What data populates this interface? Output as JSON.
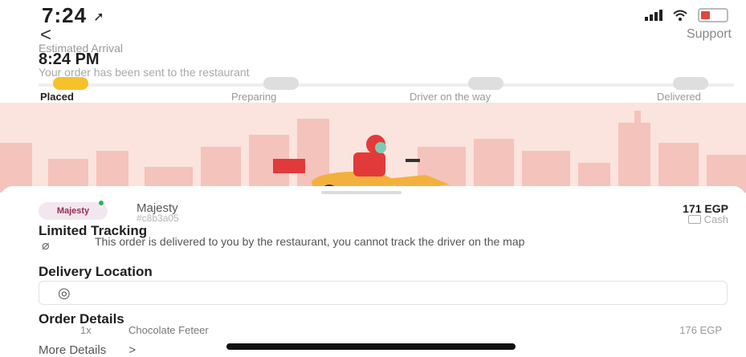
{
  "status_bar": {
    "time": "7:24",
    "location_icon": "location-arrow-icon",
    "signal_icon": "signal-icon",
    "wifi_icon": "wifi-icon",
    "battery_icon": "battery-low-icon",
    "battery_color": "#e0483c"
  },
  "nav": {
    "back_icon": "<",
    "support_label": "Support"
  },
  "eta": {
    "label": "Estimated Arrival",
    "time": "8:24 PM",
    "subtitle": "Your order has been sent to the restaurant"
  },
  "steps": [
    {
      "label": "Placed",
      "active": true
    },
    {
      "label": "Preparing",
      "active": false
    },
    {
      "label": "Driver on the way",
      "active": false
    },
    {
      "label": "Delivered",
      "active": false
    }
  ],
  "colors": {
    "accent": "#f6c12a",
    "hero_bg": "#fbe3de",
    "skyline": "#f4c3bb"
  },
  "restaurant": {
    "logo_text": "Majesty",
    "name": "Majesty",
    "order_id": "#c8b3a05",
    "price": "171 EGP",
    "payment": "Cash"
  },
  "tracking": {
    "title": "Limited Tracking",
    "message": "This order is delivered to you by the restaurant, you cannot track the driver on the map"
  },
  "delivery": {
    "title": "Delivery Location"
  },
  "order": {
    "title": "Order Details",
    "items": [
      {
        "qty": "1x",
        "name": "Chocolate Feteer",
        "price": "176 EGP"
      }
    ],
    "more_label": "More Details",
    "more_chevron": ">"
  }
}
